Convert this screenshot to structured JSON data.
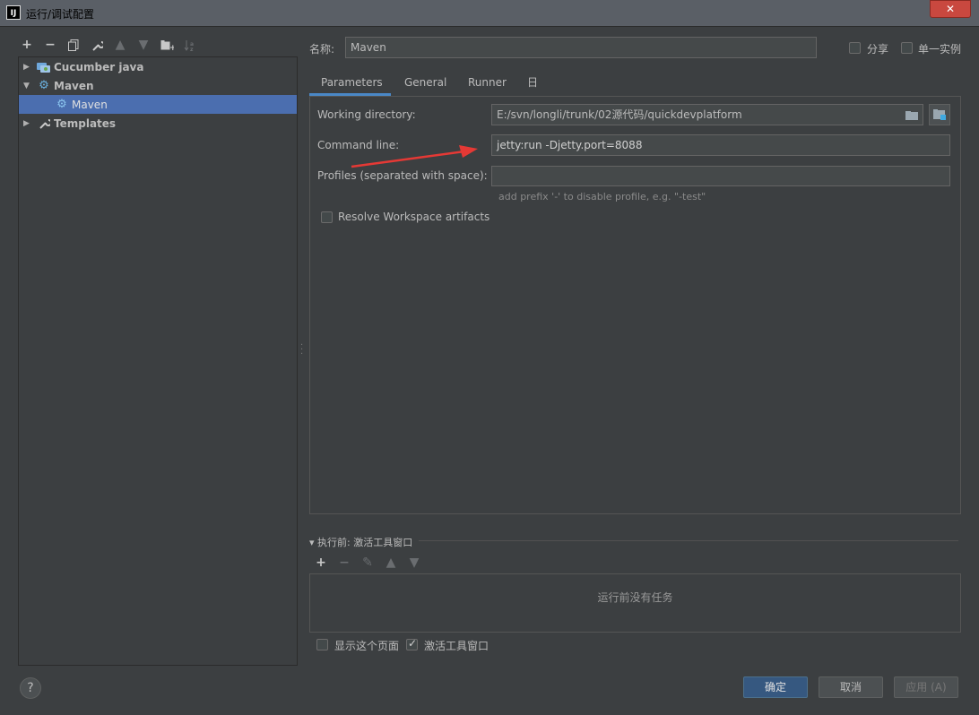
{
  "window": {
    "title": "运行/调试配置",
    "close_label": "✕"
  },
  "toolbar_left": {
    "icons": [
      "add-icon",
      "remove-icon",
      "copy-icon",
      "wrench-icon",
      "move-up-icon",
      "move-down-icon",
      "new-folder-icon",
      "sort-icon"
    ]
  },
  "tree": {
    "items": [
      {
        "label": "Cucumber java",
        "icon": "cucumber-icon",
        "expanded": false
      },
      {
        "label": "Maven",
        "icon": "maven-gear-icon",
        "expanded": true
      },
      {
        "label": "Maven",
        "icon": "maven-gear-icon",
        "selected": true
      },
      {
        "label": "Templates",
        "icon": "wrench-icon",
        "expanded": false
      }
    ]
  },
  "name_row": {
    "label": "名称:",
    "value": "Maven",
    "share_label": "分享",
    "single_instance_label": "单一实例"
  },
  "tabs": [
    {
      "label": "Parameters",
      "active": true
    },
    {
      "label": "General"
    },
    {
      "label": "Runner"
    },
    {
      "label": "日志"
    }
  ],
  "parameters": {
    "working_directory_label": "Working directory:",
    "working_directory_value": "E:/svn/longli/trunk/02源代码/quickdevplatform",
    "command_line_label": "Command line:",
    "command_line_value": "jetty:run -Djetty.port=8088",
    "profiles_label": "Profiles (separated with space):",
    "profiles_value": "",
    "profiles_hint": "add prefix '-' to disable profile, e.g. \"-test\"",
    "resolve_workspace_label": "Resolve Workspace artifacts"
  },
  "before_launch": {
    "title": "▾ 执行前: 激活工具窗口",
    "empty_text": "运行前没有任务",
    "show_page_label": "显示这个页面",
    "activate_window_label": "激活工具窗口"
  },
  "buttons": {
    "ok": "确定",
    "cancel": "取消",
    "apply": "应用 (A)",
    "help": "?"
  },
  "colors": {
    "selection": "#4b6eaf",
    "annotation_arrow": "#e53935"
  }
}
